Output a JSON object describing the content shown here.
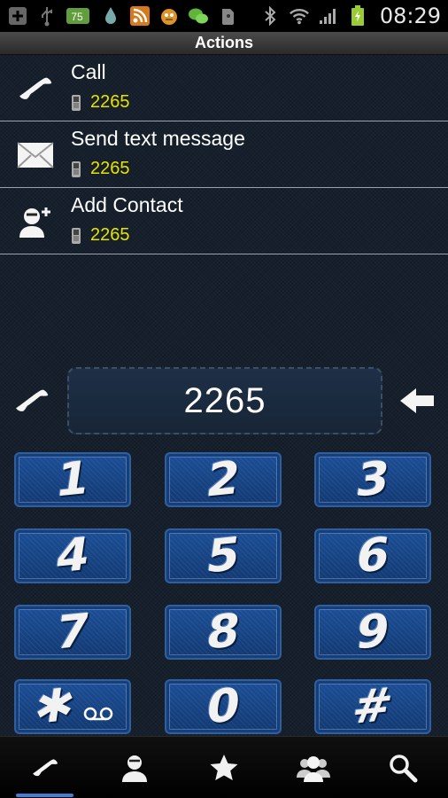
{
  "status_bar": {
    "battery_badge": "75",
    "time": "08:29",
    "icons": [
      "add-icon",
      "usb-icon",
      "battery-level-icon",
      "water-drop-icon",
      "rss-icon",
      "monster-icon",
      "wechat-icon",
      "evernote-icon",
      "bluetooth-icon",
      "wifi-icon",
      "signal-icon",
      "battery-icon"
    ]
  },
  "header": {
    "title": "Actions"
  },
  "actions": [
    {
      "label": "Call",
      "number": "2265",
      "icon": "phone-handset-icon"
    },
    {
      "label": "Send text message",
      "number": "2265",
      "icon": "envelope-icon"
    },
    {
      "label": "Add Contact",
      "number": "2265",
      "icon": "add-contact-icon"
    }
  ],
  "dialer": {
    "number": "2265"
  },
  "keypad": {
    "keys": [
      {
        "digit": "1"
      },
      {
        "digit": "2"
      },
      {
        "digit": "3"
      },
      {
        "digit": "4"
      },
      {
        "digit": "5"
      },
      {
        "digit": "6"
      },
      {
        "digit": "7"
      },
      {
        "digit": "8"
      },
      {
        "digit": "9"
      },
      {
        "digit": "✱",
        "sub_icon": "voicemail-icon"
      },
      {
        "digit": "0"
      },
      {
        "digit": "#"
      }
    ]
  },
  "bottom_nav": {
    "items": [
      "phone-icon",
      "contact-icon",
      "star-icon",
      "group-icon",
      "search-icon"
    ],
    "active": "phone-icon"
  },
  "colors": {
    "accent_number": "#e6e200",
    "nav_active": "#3f7fd4",
    "key_blue": "#1c4f97"
  }
}
